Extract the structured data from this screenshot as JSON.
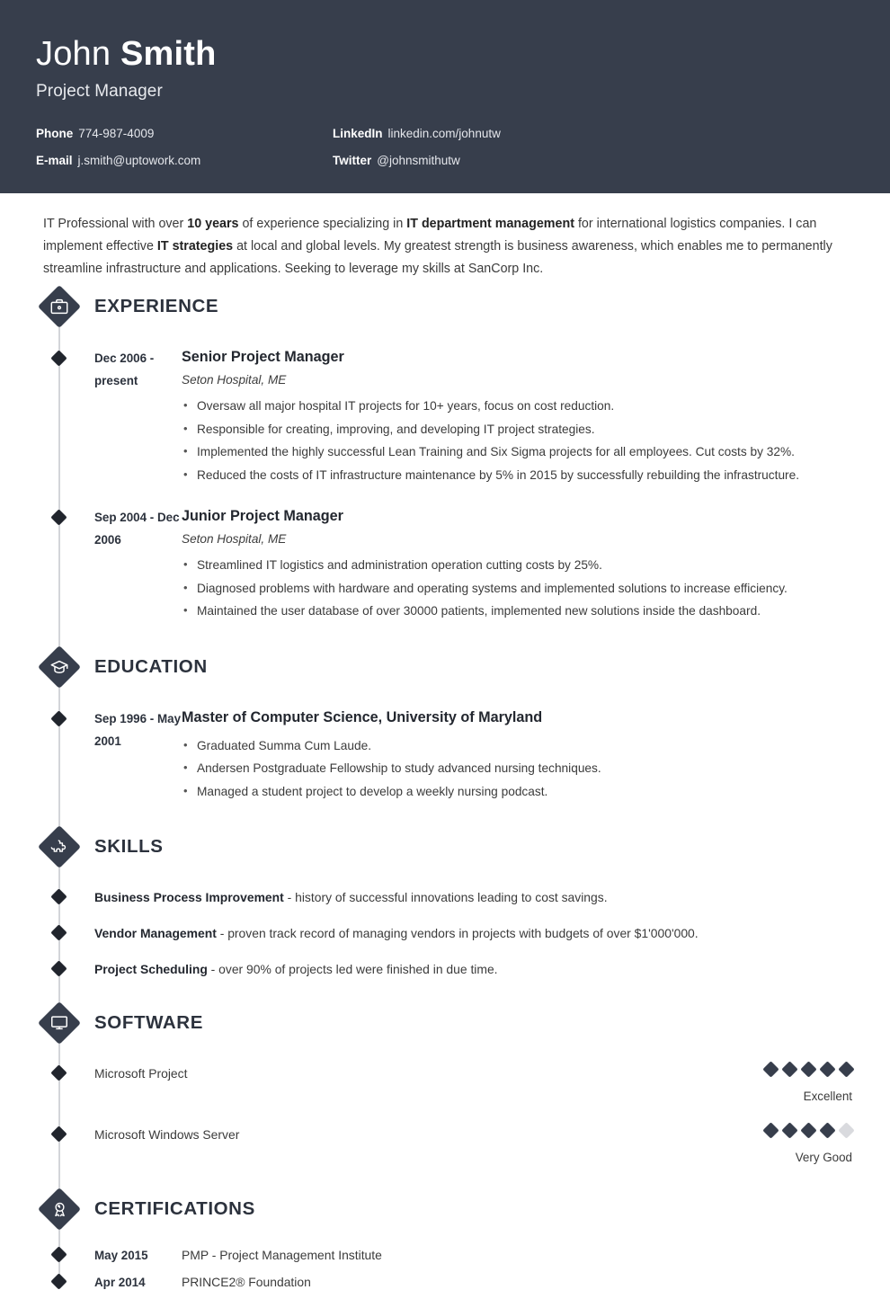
{
  "header": {
    "first_name": "John",
    "last_name": "Smith",
    "job_title": "Project Manager",
    "background_color": "#373E4C",
    "contacts": [
      {
        "label": "Phone",
        "value": "774-987-4009"
      },
      {
        "label": "LinkedIn",
        "value": "linkedin.com/johnutw"
      },
      {
        "label": "E-mail",
        "value": "j.smith@uptowork.com"
      },
      {
        "label": "Twitter",
        "value": "@johnsmithutw"
      }
    ]
  },
  "summary": {
    "part1": "IT Professional with over ",
    "bold1": "10 years",
    "part2": " of experience specializing in ",
    "bold2": "IT department management",
    "part3": " for international logistics companies. I can implement effective ",
    "bold3": "IT strategies",
    "part4": " at local and global levels. My greatest strength is business awareness, which enables me to permanently streamline infrastructure and applications. Seeking to leverage my skills at SanCorp Inc."
  },
  "sections": {
    "experience": {
      "title": "EXPERIENCE",
      "icon": "briefcase-icon",
      "entries": [
        {
          "dates": "Dec 2006 - present",
          "role": "Senior Project Manager",
          "company": "Seton Hospital, ME",
          "points": [
            "Oversaw all major hospital IT projects for 10+ years, focus on cost reduction.",
            "Responsible for creating, improving, and developing IT project strategies.",
            "Implemented the highly successful Lean Training and Six Sigma projects for all employees. Cut costs by 32%.",
            "Reduced the costs of IT infrastructure maintenance by 5% in 2015 by successfully rebuilding the infrastructure."
          ]
        },
        {
          "dates": "Sep 2004 - Dec 2006",
          "role": "Junior Project Manager",
          "company": "Seton Hospital, ME",
          "points": [
            "Streamlined IT logistics and administration operation cutting costs by 25%.",
            "Diagnosed problems with hardware and operating systems and implemented solutions to increase efficiency.",
            "Maintained the user database of over 30000 patients, implemented new solutions inside the dashboard."
          ]
        }
      ]
    },
    "education": {
      "title": "EDUCATION",
      "icon": "graduation-cap-icon",
      "entries": [
        {
          "dates": "Sep 1996 - May 2001",
          "role": "Master of Computer Science, University of Maryland",
          "company": "",
          "points": [
            "Graduated Summa Cum Laude.",
            "Andersen Postgraduate Fellowship to study advanced nursing techniques.",
            "Managed a student project to develop a weekly nursing podcast."
          ]
        }
      ]
    },
    "skills": {
      "title": "SKILLS",
      "icon": "puzzle-piece-icon",
      "items": [
        {
          "name": "Business Process Improvement",
          "description": " - history of successful innovations leading to cost savings."
        },
        {
          "name": "Vendor Management",
          "description": " - proven track record of managing vendors in projects with budgets of over $1'000'000."
        },
        {
          "name": "Project Scheduling",
          "description": " - over 90% of projects led were finished in due time."
        }
      ]
    },
    "software": {
      "title": "SOFTWARE",
      "icon": "monitor-icon",
      "max_rating": 5,
      "items": [
        {
          "name": "Microsoft Project",
          "rating": 5,
          "rating_label": "Excellent"
        },
        {
          "name": "Microsoft Windows Server",
          "rating": 4,
          "rating_label": "Very Good"
        }
      ]
    },
    "certifications": {
      "title": "CERTIFICATIONS",
      "icon": "award-ribbon-icon",
      "items": [
        {
          "date": "May 2015",
          "name": "PMP - Project Management Institute"
        },
        {
          "date": "Apr 2014",
          "name": "PRINCE2® Foundation"
        }
      ]
    }
  }
}
